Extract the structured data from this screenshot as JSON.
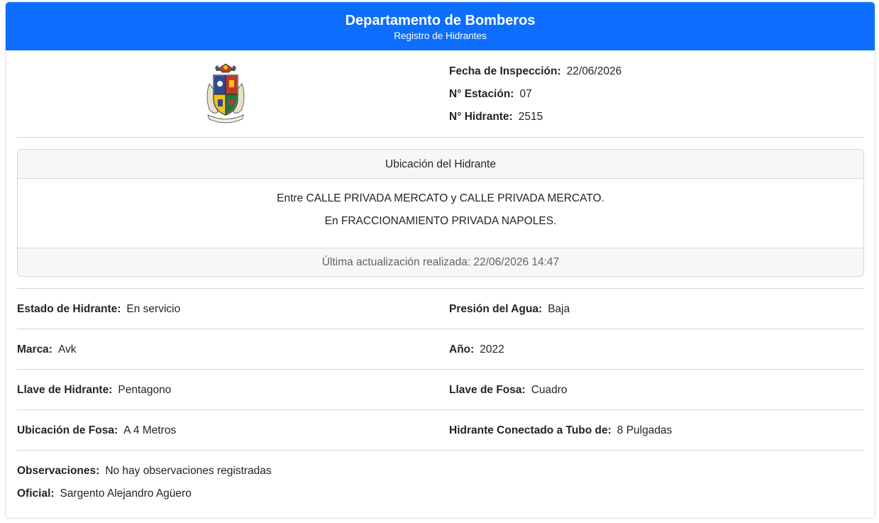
{
  "header": {
    "title": "Departamento de Bomberos",
    "subtitle": "Registro de Hidrantes"
  },
  "logo": {
    "icon": "coat-of-arms-icon"
  },
  "info": {
    "fecha_label": "Fecha de Inspección:",
    "fecha_value": "22/06/2026",
    "estacion_label": "N° Estación:",
    "estacion_value": "07",
    "hidrante_label": "N° Hidrante:",
    "hidrante_value": "2515"
  },
  "ubicacion": {
    "header": "Ubicación del Hidrante",
    "line1": "Entre CALLE PRIVADA MERCATO y CALLE PRIVADA MERCATO.",
    "line2": "En FRACCIONAMIENTO PRIVADA NAPOLES.",
    "footer": "Última actualización realizada: 22/06/2026 14:47"
  },
  "details": {
    "estado_label": "Estado de Hidrante:",
    "estado_value": "En servicio",
    "presion_label": "Presión del Agua:",
    "presion_value": "Baja",
    "marca_label": "Marca:",
    "marca_value": "Avk",
    "anio_label": "Año:",
    "anio_value": "2022",
    "llave_hidrante_label": "Llave de Hidrante:",
    "llave_hidrante_value": "Pentagono",
    "llave_fosa_label": "Llave de Fosa:",
    "llave_fosa_value": "Cuadro",
    "ubicacion_fosa_label": "Ubicación de Fosa:",
    "ubicacion_fosa_value": "A 4 Metros",
    "tubo_label": "Hidrante Conectado a Tubo de:",
    "tubo_value": "8 Pulgadas",
    "observaciones_label": "Observaciones:",
    "observaciones_value": "No hay observaciones registradas",
    "oficial_label": "Oficial:",
    "oficial_value": "Sargento Alejandro Agüero"
  },
  "colors": {
    "header_bg": "#0d6efd",
    "muted_text": "#5c636a",
    "panel_bg": "#f7f7f7"
  }
}
